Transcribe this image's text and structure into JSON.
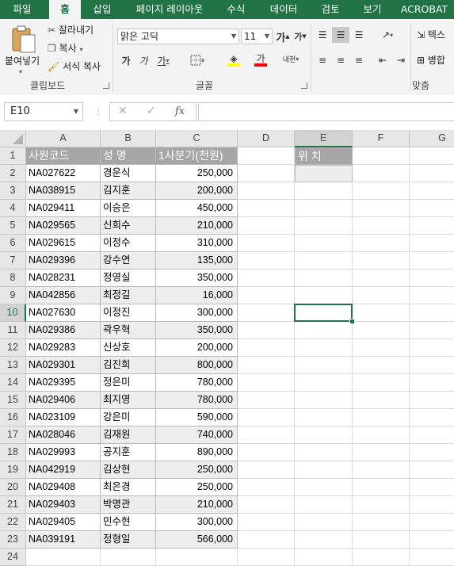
{
  "ribbon_tabs": [
    "파일",
    "홈",
    "삽입",
    "페이지 레이아웃",
    "수식",
    "데이터",
    "검토",
    "보기",
    "ACROBAT"
  ],
  "active_tab": "홈",
  "clipboard": {
    "paste": "붙여넣기",
    "cut": "잘라내기",
    "copy": "복사",
    "format_painter": "서식 복사",
    "group_label": "클립보드"
  },
  "font": {
    "name": "맑은 고딕",
    "size": "11",
    "grow": "가",
    "shrink": "가",
    "bold": "가",
    "italic": "가",
    "underline": "가",
    "font_color_glyph": "가",
    "phonetic": "내천",
    "group_label": "글꼴",
    "fill_color": "#FFFF00",
    "font_color": "#FF0000"
  },
  "alignment": {
    "wrap_text": "텍스",
    "merge": "병합",
    "group_label": "맞춤"
  },
  "formula_bar": {
    "name_box": "E10",
    "cancel": "✕",
    "enter": "✓",
    "fx": "fx",
    "formula": ""
  },
  "columns": [
    "A",
    "B",
    "C",
    "D",
    "E",
    "F",
    "G"
  ],
  "selected_cell": "E10",
  "headers": {
    "code": "사원코드",
    "name": "성   명",
    "sales": "1사분기(천원)",
    "position": "위 치"
  },
  "rows": [
    {
      "code": "NA027622",
      "name": "경운식",
      "sales": "250,000"
    },
    {
      "code": "NA038915",
      "name": "김지훈",
      "sales": "200,000"
    },
    {
      "code": "NA029411",
      "name": "이승은",
      "sales": "450,000"
    },
    {
      "code": "NA029565",
      "name": "신희수",
      "sales": "210,000"
    },
    {
      "code": "NA029615",
      "name": "이정수",
      "sales": "310,000"
    },
    {
      "code": "NA029396",
      "name": "강수연",
      "sales": "135,000"
    },
    {
      "code": "NA028231",
      "name": "정영실",
      "sales": "350,000"
    },
    {
      "code": "NA042856",
      "name": "최정길",
      "sales": "16,000"
    },
    {
      "code": "NA027630",
      "name": "이정진",
      "sales": "300,000"
    },
    {
      "code": "NA029386",
      "name": "곽우혁",
      "sales": "350,000"
    },
    {
      "code": "NA029283",
      "name": "신상호",
      "sales": "200,000"
    },
    {
      "code": "NA029301",
      "name": "김진희",
      "sales": "800,000"
    },
    {
      "code": "NA029395",
      "name": "정은미",
      "sales": "780,000"
    },
    {
      "code": "NA029406",
      "name": "최지영",
      "sales": "780,000"
    },
    {
      "code": "NA023109",
      "name": "강은미",
      "sales": "590,000"
    },
    {
      "code": "NA028046",
      "name": "김재원",
      "sales": "740,000"
    },
    {
      "code": "NA029993",
      "name": "공지훈",
      "sales": "890,000"
    },
    {
      "code": "NA042919",
      "name": "김상현",
      "sales": "250,000"
    },
    {
      "code": "NA029408",
      "name": "최은경",
      "sales": "250,000"
    },
    {
      "code": "NA029403",
      "name": "박명관",
      "sales": "210,000"
    },
    {
      "code": "NA029405",
      "name": "민수현",
      "sales": "300,000"
    },
    {
      "code": "NA039191",
      "name": "정형일",
      "sales": "566,000"
    }
  ],
  "row_numbers": [
    "1",
    "2",
    "3",
    "4",
    "5",
    "6",
    "7",
    "8",
    "9",
    "10",
    "11",
    "12",
    "13",
    "14",
    "15",
    "16",
    "17",
    "18",
    "19",
    "20",
    "21",
    "22",
    "23",
    "24"
  ]
}
